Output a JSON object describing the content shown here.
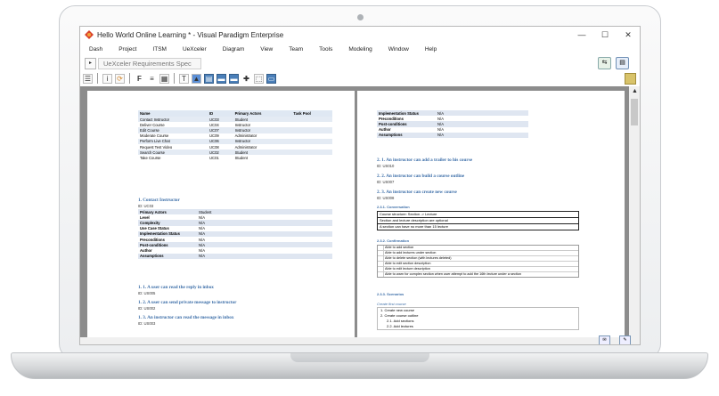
{
  "window": {
    "title": "Hello World Online Learning * - Visual Paradigm Enterprise",
    "controls": [
      "—",
      "☐",
      "✕"
    ]
  },
  "menu": [
    "Dash",
    "Project",
    "ITSM",
    "UeXceler",
    "Diagram",
    "View",
    "Team",
    "Tools",
    "Modeling",
    "Window",
    "Help"
  ],
  "breadcrumb": "UeXceler Requirements Spec",
  "left_page": {
    "usecase_table": {
      "headers": [
        "Name",
        "ID",
        "Primary Actors",
        "Task Pool"
      ],
      "rows": [
        [
          "Contact Instructor",
          "UC03",
          "Student",
          ""
        ],
        [
          "Deliver Course",
          "UC04",
          "Instructor",
          ""
        ],
        [
          "Edit Course",
          "UC07",
          "Instructor",
          ""
        ],
        [
          "Moderate Course",
          "UC09",
          "Administrator",
          ""
        ],
        [
          "Perform Live Chat",
          "UC06",
          "Instructor",
          ""
        ],
        [
          "Request Test Video",
          "UC08",
          "Administrator",
          ""
        ],
        [
          "Search Course",
          "UC02",
          "Student",
          ""
        ],
        [
          "Take Course",
          "UC01",
          "Student",
          ""
        ]
      ]
    },
    "section_title": "1. Contact Instructor",
    "section_id": "ID: UC03",
    "properties": [
      [
        "Primary Actors",
        "Student"
      ],
      [
        "Level",
        "N/A"
      ],
      [
        "Complexity",
        "N/A"
      ],
      [
        "Use Case Status",
        "N/A"
      ],
      [
        "Implementation Status",
        "N/A"
      ],
      [
        "Preconditions",
        "N/A"
      ],
      [
        "Post-conditions",
        "N/A"
      ],
      [
        "Author",
        "N/A"
      ],
      [
        "Assumptions",
        "N/A"
      ]
    ],
    "stories": [
      {
        "title": "1. 1. A user can read the reply in inbox",
        "id": "ID: US005"
      },
      {
        "title": "1. 2. A user can send private message to instructor",
        "id": "ID: US002"
      },
      {
        "title": "1. 3. An instructor can read the message in inbox",
        "id": "ID: US003"
      }
    ]
  },
  "right_page": {
    "properties": [
      [
        "Implementation Status",
        "N/A"
      ],
      [
        "Preconditions",
        "N/A"
      ],
      [
        "Post-conditions",
        "N/A"
      ],
      [
        "Author",
        "N/A"
      ],
      [
        "Assumptions",
        "N/A"
      ]
    ],
    "stories": [
      {
        "title": "2. 1. An instructor can add a trailer to his course",
        "id": "ID: US010"
      },
      {
        "title": "2. 2. An instructor can build a course outline",
        "id": "ID: US007"
      },
      {
        "title": "2. 3. An instructor can create new course",
        "id": "ID: US008"
      }
    ],
    "conversation_label": "2.3.1. Conversation",
    "conversation": [
      "Course structure: Section -> Lecture",
      "Section and lecture description are optional",
      "A section can have no more than 15 lecture"
    ],
    "confirmation_label": "2.3.2. Confirmation",
    "confirmation": [
      "Able to add section",
      "Able to add lectures under section",
      "Able to delete section (with lectures deleted)",
      "Able to edit section description",
      "Able to edit lecture description",
      "Able to warn for complex section when user attempt to add the 16th lecture under a section"
    ],
    "scenarios_label": "2.3.3. Scenarios",
    "scenario_title": "Create first course",
    "scenario_steps": [
      "1. Create new course",
      "2. Create course outline",
      "2.1. Add sections",
      "2.2. Add lectures"
    ]
  },
  "colors": {
    "heading_blue": "#3c6ea8",
    "table_header": "#dfe8f3",
    "workspace_gray": "#8c8c8c"
  }
}
